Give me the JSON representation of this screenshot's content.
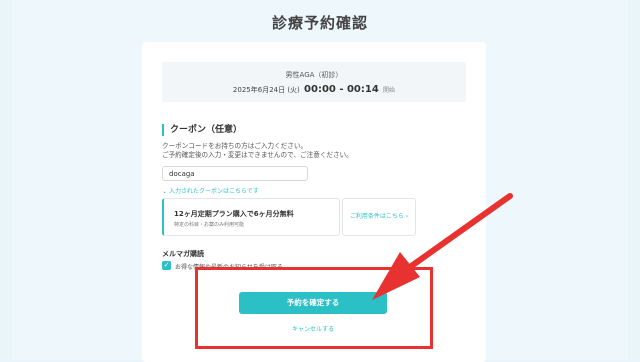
{
  "page": {
    "title": "診療予約確認"
  },
  "summary": {
    "plan": "男性AGA（初診）",
    "date": "2025年6月24日 (火)",
    "time": "00:00 - 00:14",
    "time_suffix": "開始"
  },
  "coupon": {
    "heading": "クーポン（任意）",
    "desc_line1": "クーポンコードをお持ちの方はご入力ください。",
    "desc_line2": "ご予約確定後の入力・変更はできませんので、ご注意ください。",
    "input_value": "docaga",
    "toggle_label": "入力されたクーポンはこちらです",
    "applied_title": "12ヶ月定期プラン購入で6ヶ月分無料",
    "applied_note": "特定の科目・お薬のみ利用可能",
    "terms_link": "ご利用条件はこちら"
  },
  "newsletter": {
    "heading": "メルマガ購読",
    "checkbox_label": "お得な情報や最新のお知らせを受け取る",
    "checked": true
  },
  "actions": {
    "confirm": "予約を確定する",
    "cancel": "キャンセルする"
  },
  "colors": {
    "accent": "#2bbfc6",
    "annotation": "#e8322f"
  },
  "icons": {
    "check": "check-icon",
    "chevron": "chevron-right-icon",
    "chevron_down": "chevron-down-icon"
  }
}
